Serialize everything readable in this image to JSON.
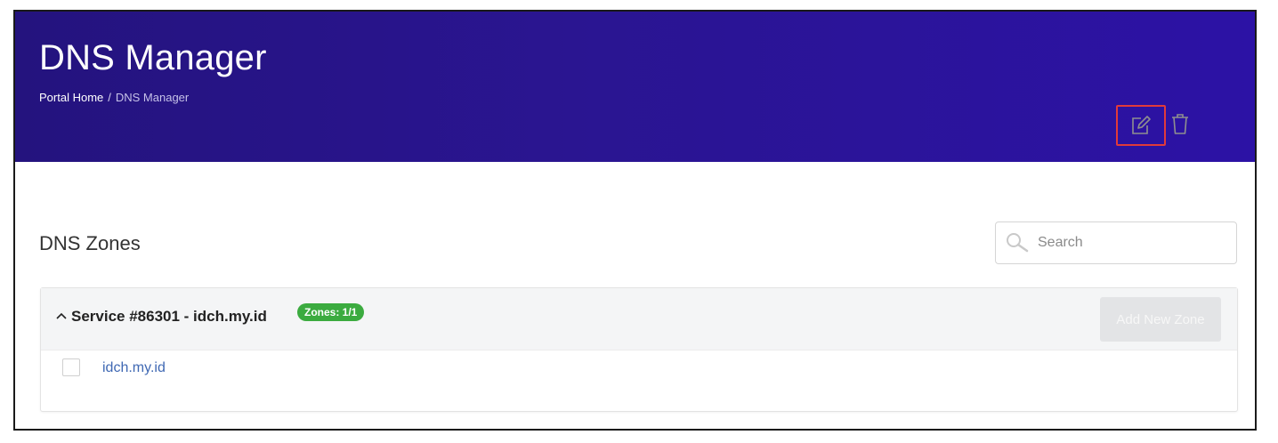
{
  "header": {
    "title": "DNS Manager",
    "breadcrumb": {
      "home": "Portal Home",
      "separator": "/",
      "current": "DNS Manager"
    }
  },
  "section": {
    "title": "DNS Zones"
  },
  "search": {
    "placeholder": "Search",
    "value": ""
  },
  "service": {
    "title": "Service #86301 - idch.my.id",
    "badge": "Zones: 1/1",
    "add_button_label": "Add New Zone",
    "collapse_icon": "chevron-up-icon"
  },
  "zones": [
    {
      "name": "idch.my.id",
      "checked": false,
      "actions": [
        "edit-icon",
        "trash-icon"
      ]
    }
  ],
  "colors": {
    "header_bg": "#2a1591",
    "badge": "#3bab3f",
    "link": "#3f68b3",
    "highlight": "#e13a3a"
  }
}
